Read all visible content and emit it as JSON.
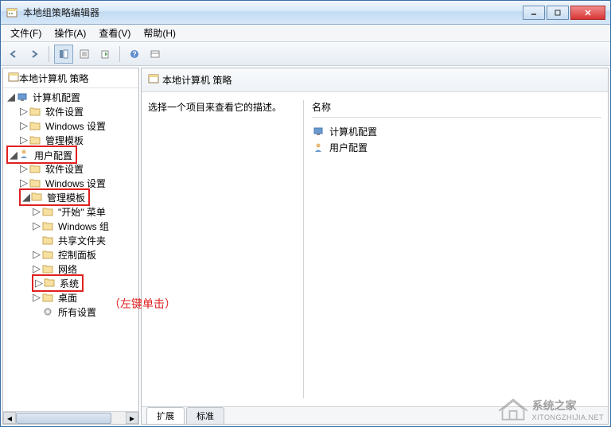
{
  "window": {
    "title": "本地组策略编辑器"
  },
  "menu": {
    "file": "文件(F)",
    "action": "操作(A)",
    "view": "查看(V)",
    "help": "帮助(H)"
  },
  "tree": {
    "root": "本地计算机 策略",
    "computer_config": "计算机配置",
    "software_settings": "软件设置",
    "windows_settings": "Windows 设置",
    "admin_templates": "管理模板",
    "user_config": "用户配置",
    "software_settings2": "软件设置",
    "windows_settings2": "Windows 设置",
    "admin_templates2": "管理模板",
    "start_menu": "\"开始\" 菜单",
    "windows_comp": "Windows 组",
    "shared_folders": "共享文件夹",
    "control_panel": "控制面板",
    "network": "网络",
    "system": "系统",
    "desktop": "桌面",
    "all_settings": "所有设置"
  },
  "detail": {
    "header": "本地计算机 策略",
    "prompt": "选择一个项目来查看它的描述。",
    "col_name": "名称",
    "row_computer": "计算机配置",
    "row_user": "用户配置"
  },
  "tabs": {
    "extended": "扩展",
    "standard": "标准"
  },
  "annotation": "（左键单击）",
  "watermark": {
    "text1": "系统之家",
    "text2": "XITONGZHIJIA.NET"
  }
}
